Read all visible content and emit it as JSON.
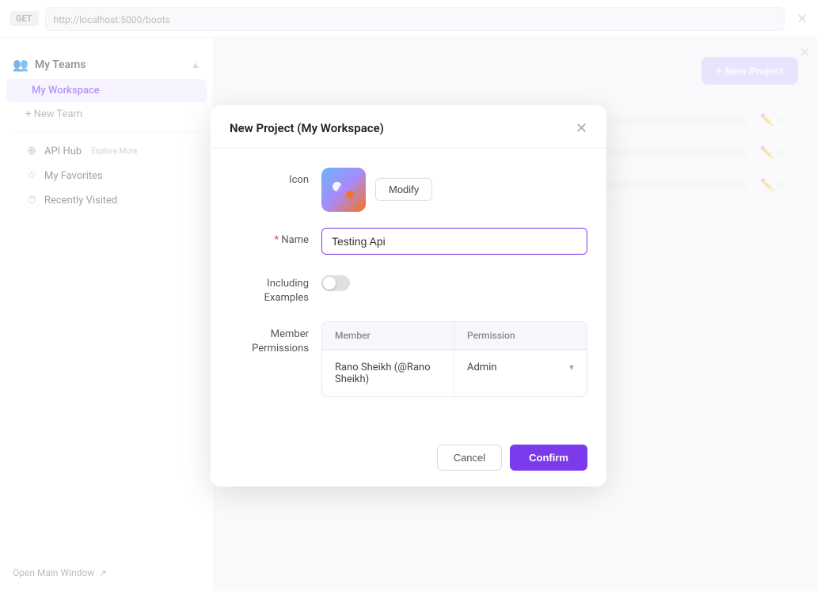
{
  "topbar": {
    "method": "GET",
    "url": "http://localhost:5000/boots"
  },
  "sidebar": {
    "my_teams_label": "My Teams",
    "workspace_label": "My Workspace",
    "new_team_label": "+ New Team",
    "api_hub_label": "API Hub",
    "api_hub_tag": "Explore More",
    "my_favorites_label": "My Favorites",
    "recently_visited_label": "Recently Visited",
    "open_main_window_label": "Open Main Window"
  },
  "main": {
    "new_project_label": "+ New Project"
  },
  "dialog": {
    "title": "New Project (My Workspace)",
    "icon_label": "Icon",
    "modify_label": "Modify",
    "name_label": "Name",
    "name_value": "Testing Api",
    "including_examples_label": "Including\nExamples",
    "member_permissions_label": "Member\nPermissions",
    "table": {
      "col_member": "Member",
      "col_permission": "Permission",
      "rows": [
        {
          "member": "Rano Sheikh (@Rano Sheikh)",
          "permission": "Admin"
        }
      ]
    },
    "cancel_label": "Cancel",
    "confirm_label": "Confirm"
  }
}
